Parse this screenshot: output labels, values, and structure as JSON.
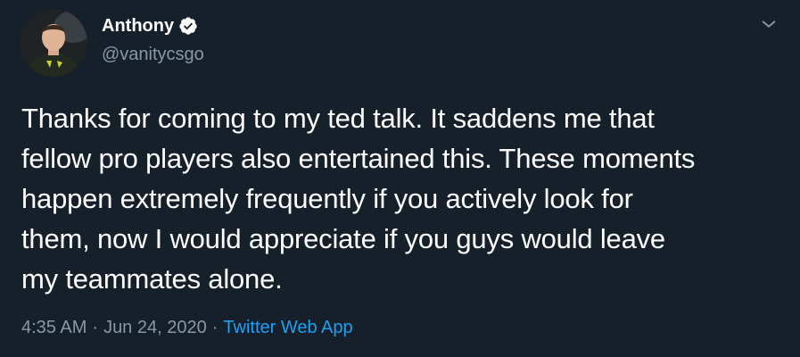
{
  "author": {
    "display_name": "Anthony",
    "handle": "@vanitycsgo",
    "verified": true
  },
  "tweet": {
    "text_lines": [
      "Thanks for coming to my ted talk. It saddens me that",
      "fellow pro players also entertained this. These moments",
      "happen extremely frequently if you actively look for",
      "them, now I would appreciate if you guys would leave",
      "my teammates alone."
    ],
    "time": "4:35 AM",
    "separator": "·",
    "date": "Jun 24, 2020",
    "source": "Twitter Web App"
  },
  "icons": {
    "verified": "verified-badge-icon",
    "more": "chevron-down-icon"
  },
  "colors": {
    "background": "#15202b",
    "text_primary": "#ffffff",
    "text_secondary": "#8899a6",
    "accent": "#1da1f2"
  }
}
